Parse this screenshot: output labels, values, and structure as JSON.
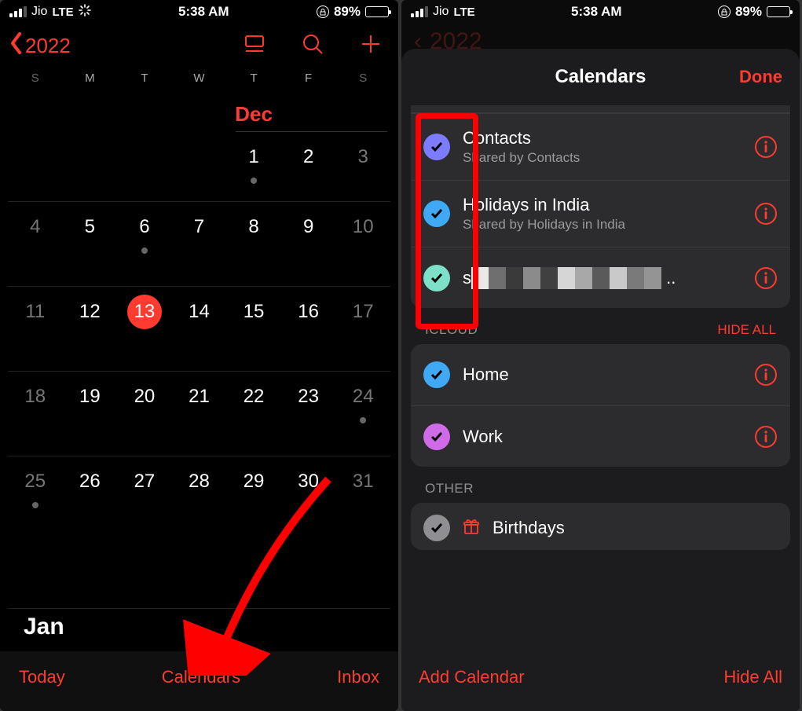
{
  "status": {
    "carrier": "Jio",
    "network": "LTE",
    "time": "5:38 AM",
    "battery_pct": "89%",
    "battery_fill": 89
  },
  "left": {
    "back_label": "2022",
    "weekdays": [
      "S",
      "M",
      "T",
      "W",
      "T",
      "F",
      "S"
    ],
    "month_label": "Dec",
    "next_month_label": "Jan",
    "today": 13,
    "dots": [
      1,
      6,
      24,
      25
    ],
    "toolbar": {
      "today": "Today",
      "calendars": "Calendars",
      "inbox": "Inbox"
    }
  },
  "right": {
    "sheet_title": "Calendars",
    "done": "Done",
    "group1": [
      {
        "title": "Contacts",
        "sub": "Shared by Contacts",
        "color": "#7d7bff"
      },
      {
        "title": "Holidays in India",
        "sub": "Shared by Holidays in India",
        "color": "#3fa9f5"
      },
      {
        "title": "s",
        "sub": "",
        "color": "#7de0c9",
        "obscured": true
      }
    ],
    "icloud_label": "ICLOUD",
    "hide_all": "HIDE ALL",
    "icloud": [
      {
        "title": "Home",
        "color": "#3fa9f5"
      },
      {
        "title": "Work",
        "color": "#d06be8"
      }
    ],
    "other_label": "OTHER",
    "other": [
      {
        "title": "Birthdays",
        "color": "#8e8e93",
        "gift": true
      }
    ],
    "toolbar": {
      "add": "Add Calendar",
      "hide": "Hide All"
    }
  }
}
